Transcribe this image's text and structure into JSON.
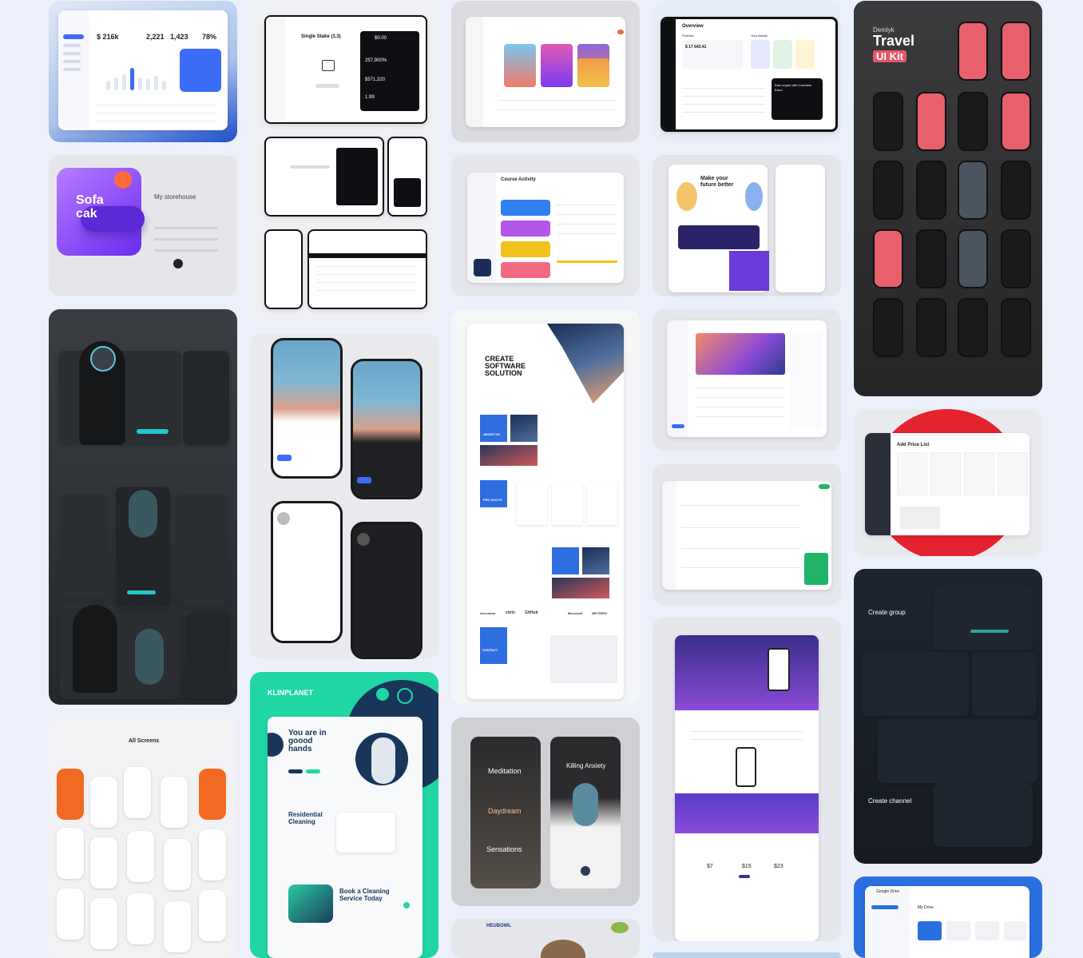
{
  "cards": {
    "sofa": {
      "title": "Sofa cak",
      "subtitle": "My storehouse"
    },
    "travel": {
      "brand": "Demlyk",
      "title": "Travel",
      "badge": "UI Kit"
    },
    "overview": {
      "title": "Overview",
      "subtitle": "Portfolio",
      "assets": "Your Assets",
      "amount": "$ 17 643.41",
      "promo": "Earn crypto with Coinview Earn!"
    },
    "stake": {
      "title": "Single Stake (3,3)",
      "amount": "$0.00",
      "value1": "257,900%",
      "value2": "$571,320",
      "value3": "1.99"
    },
    "course": {
      "title": "Course Activity"
    },
    "future": {
      "title": "Make your future better"
    },
    "software": {
      "title": "CREATE SOFTWARE SOLUTION",
      "about": "ABOUT US",
      "products": "PRO DUCTS",
      "contact": "CONTACT",
      "logos": [
        "Accenture",
        "citrix",
        "GitHub",
        "Microsoft",
        "NETZERO"
      ]
    },
    "price": {
      "title": "Add Price List"
    },
    "cleaning": {
      "brand": "KLINPLANET",
      "headline": "You are in goood hands",
      "service": "Residential Cleaning",
      "book": "Book a Cleaning Service Today"
    },
    "group": {
      "create_group": "Create group",
      "create_channel": "Create channel"
    },
    "screens": {
      "title": "All Screens"
    },
    "meditation": {
      "title": "Meditation",
      "daydream": "Daydream",
      "sensations": "Sensations",
      "anxiety": "Killing Anxiety"
    },
    "drive": {
      "title": "Google Drive",
      "sub": "My Drive"
    },
    "pricing": {
      "p1": "$7",
      "p2": "$15",
      "p3": "$23"
    },
    "bowl": {
      "brand": "HEUBOWL"
    }
  }
}
